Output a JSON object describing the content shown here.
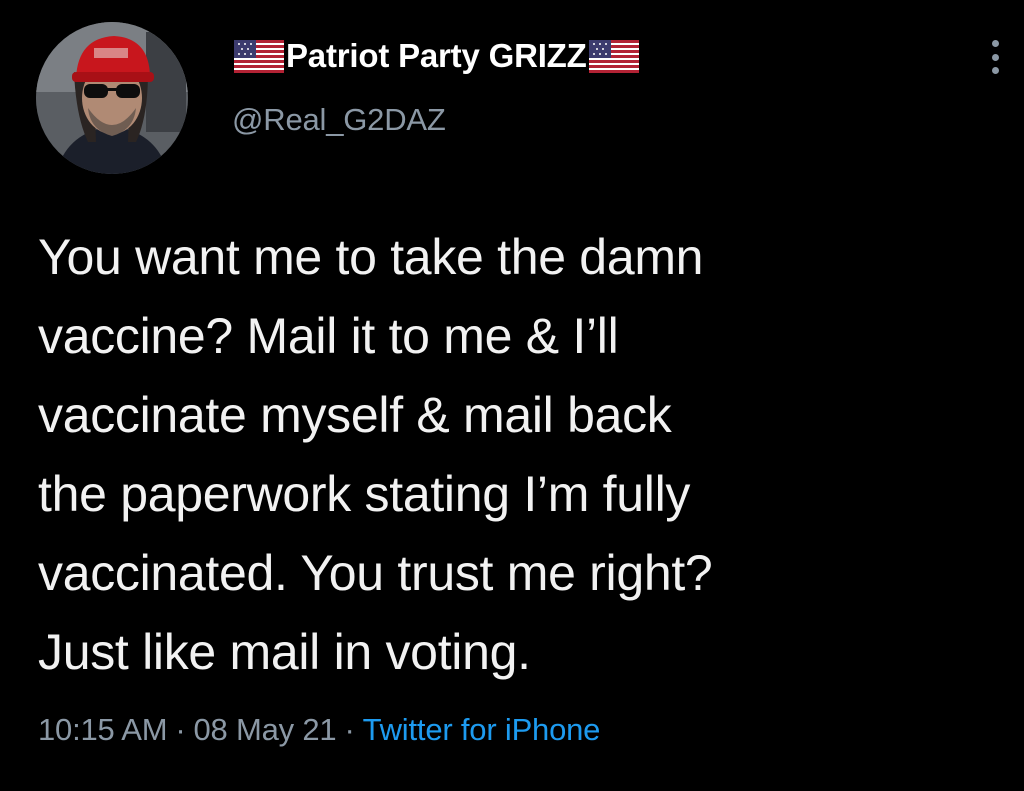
{
  "tweet": {
    "display_name": "Patriot Party GRIZZ",
    "handle": "@Real_G2DAZ",
    "text": "You want me to take the damn\nvaccine? Mail it to me & I’ll\nvaccinate myself & mail back\nthe paperwork stating I’m fully\nvaccinated. You trust me right?\nJust like mail in voting.",
    "time": "10:15 AM",
    "date": "08 May 21",
    "separator": "·",
    "source": "Twitter for iPhone"
  },
  "icons": {
    "flag_left": "us-flag-icon",
    "flag_right": "us-flag-icon",
    "more": "more-options-icon"
  },
  "colors": {
    "background": "#000000",
    "name": "#ffffff",
    "secondary": "#8b98a5",
    "link": "#1d9bf0"
  }
}
